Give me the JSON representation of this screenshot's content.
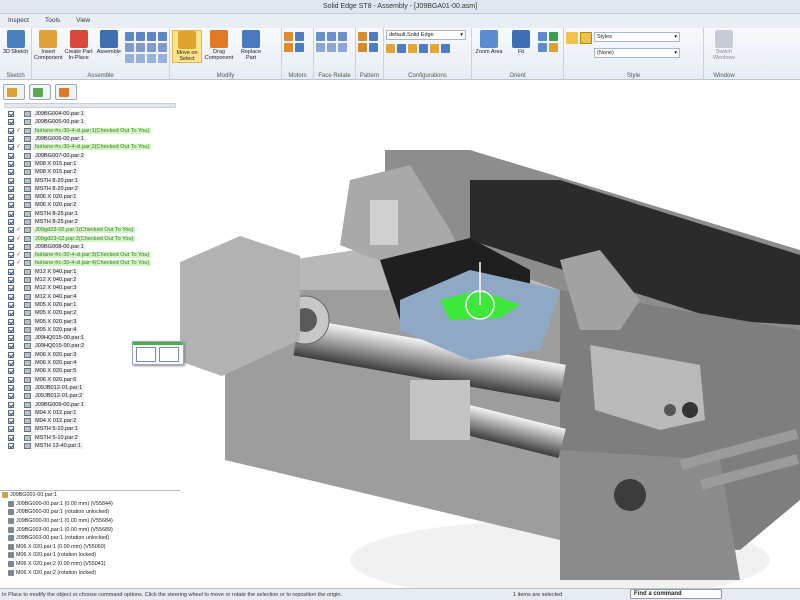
{
  "app": {
    "title": "Solid Edge ST8 - Assembly - [J09BGA01-00.asm]"
  },
  "menu_tabs": [
    "Inspect",
    "Tools",
    "View"
  ],
  "ribbon": {
    "sketch": {
      "btn": "3D Sketch",
      "label": "Sketch"
    },
    "assemble": {
      "insert": "Insert Component",
      "create": "Create Part In-Place",
      "assemble": "Assemble",
      "label": "Assemble"
    },
    "modify": {
      "move": "Move on Select",
      "drag": "Drag Component",
      "replace": "Replace Part",
      "label": "Modify"
    },
    "motors": {
      "label": "Motors"
    },
    "face_relate": {
      "label": "Face Relate"
    },
    "pattern": {
      "label": "Pattern"
    },
    "configurations": {
      "combo": "default,Solid Edge",
      "label": "Configurations"
    },
    "orient": {
      "zoom": "Zoom Area",
      "fit": "Fit",
      "label": "Orient"
    },
    "style": {
      "styles": "Styles",
      "none": "(None)",
      "label": "Style"
    },
    "window": {
      "switch": "Switch Windows",
      "label": "Window"
    }
  },
  "tree": [
    {
      "name": "J09BG004-00.par:1",
      "co": false
    },
    {
      "name": "J09BG005-00.par:1",
      "co": false
    },
    {
      "name": "fairlane-frc-30-4-sl.par:1(Checked Out To You)",
      "co": true
    },
    {
      "name": "J09BG006-00.par:1",
      "co": false
    },
    {
      "name": "fairlane-frc-30-4-sl.par:2(Checked Out To You)",
      "co": true
    },
    {
      "name": "J09BG007-00.par:2",
      "co": false
    },
    {
      "name": "M08 X 015.par:1",
      "co": false
    },
    {
      "name": "M08 X 015.par:2",
      "co": false
    },
    {
      "name": "MSTH 8-20.par:1",
      "co": false
    },
    {
      "name": "MSTH 8-20.par:2",
      "co": false
    },
    {
      "name": "M06 X 020.par:1",
      "co": false
    },
    {
      "name": "M06 X 020.par:2",
      "co": false
    },
    {
      "name": "MSTH 8-25.par:1",
      "co": false
    },
    {
      "name": "MSTH 8-25.par:2",
      "co": false
    },
    {
      "name": "J09gd23-02.par:1(Checked Out To You)",
      "co": true
    },
    {
      "name": "J09gd23-02.par:2(Checked Out To You)",
      "co": true
    },
    {
      "name": "J09BG008-00.par:1",
      "co": false
    },
    {
      "name": "fairlane-frc-30-4-sl.par:3(Checked Out To You)",
      "co": true
    },
    {
      "name": "fairlane-frc-30-4-sl.par:4(Checked Out To You)",
      "co": true
    },
    {
      "name": "M12 X 040.par:1",
      "co": false
    },
    {
      "name": "M12 X 040.par:2",
      "co": false
    },
    {
      "name": "M12 X 040.par:3",
      "co": false
    },
    {
      "name": "M12 X 040.par:4",
      "co": false
    },
    {
      "name": "M05 X 020.par:1",
      "co": false
    },
    {
      "name": "M05 X 020.par:2",
      "co": false
    },
    {
      "name": "M05 X 020.par:3",
      "co": false
    },
    {
      "name": "M05 X 020.par:4",
      "co": false
    },
    {
      "name": "J09HQ015-00.par:1",
      "co": false
    },
    {
      "name": "J09HQ015-00.par:2",
      "co": false
    },
    {
      "name": "M06 X 020.par:3",
      "co": false
    },
    {
      "name": "M06 X 020.par:4",
      "co": false
    },
    {
      "name": "M06 X 020.par:5",
      "co": false
    },
    {
      "name": "M06 X 020.par:6",
      "co": false
    },
    {
      "name": "J09JB012-01.par:1",
      "co": false
    },
    {
      "name": "J09JB012-01.par:2",
      "co": false
    },
    {
      "name": "J09BG009-00.par:1",
      "co": false
    },
    {
      "name": "M04 X 012.par:1",
      "co": false
    },
    {
      "name": "M04 X 012.par:2",
      "co": false
    },
    {
      "name": "MSTH 5-10.par:1",
      "co": false
    },
    {
      "name": "MSTH 5-10.par:2",
      "co": false
    },
    {
      "name": "MSTH 13-40.par:1",
      "co": false
    }
  ],
  "detail_root": "J09BG001-00.par:1",
  "details": [
    "J09BG000-00.par:1  (0.00 mm)  (V55844)",
    "J09BG000-00.par:1  (rotation unlocked)",
    "J09BG000-00.par:1  (0.00 mm)  (V55684)",
    "J09BG003-00.par:1  (0.00 mm)  (V55689)",
    "J09BG003-00.par:1  (rotation unlocked)",
    "M06 X 020.par:1  (0.00 mm)  (V55060)",
    "M06 X 020.par:1  (rotation locked)",
    "M06 X 020.par:2  (0.00 mm)  (V55041)",
    "M06 X 020.par:2  (rotation locked)"
  ],
  "status": {
    "prompt": "In Place to modify the object or choose command options. Click the steering wheel to move or rotate the selection or to reposition the origin.",
    "selection": "1 items are selected",
    "find": "Find a command"
  },
  "colors": {
    "accent": "#ffe28a",
    "checked_out": "#2b8a1f",
    "selection_green": "#3ee83a"
  }
}
